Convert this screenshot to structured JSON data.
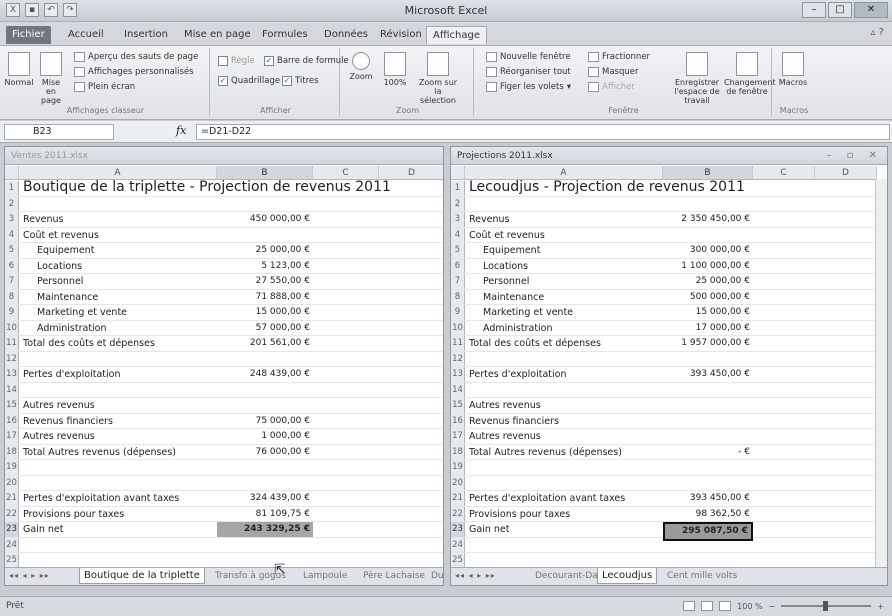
{
  "app": {
    "title": "Microsoft Excel"
  },
  "tabs": [
    "Fichier",
    "Accueil",
    "Insertion",
    "Mise en page",
    "Formules",
    "Données",
    "Révision",
    "Affichage"
  ],
  "active_tab": "Affichage",
  "ribbon": {
    "workbook_views": {
      "normal": "Normal",
      "page_layout": "Mise en page",
      "page_break": "Aperçu des sauts de page",
      "custom": "Affichages personnalisés",
      "fullscreen": "Plein écran",
      "label": "Affichages classeur"
    },
    "show": {
      "ruler": "Règle",
      "formula_bar": "Barre de formule",
      "gridlines": "Quadrillage",
      "headings": "Titres",
      "label": "Afficher"
    },
    "zoom": {
      "zoom": "Zoom",
      "zoom100": "100%",
      "zoom_sel": "Zoom sur la sélection",
      "label": "Zoom"
    },
    "window": {
      "new_window": "Nouvelle fenêtre",
      "arrange_all": "Réorganiser tout",
      "freeze": "Figer les volets",
      "split": "Fractionner",
      "hide": "Masquer",
      "unhide": "Afficher",
      "save_ws": "Enregistrer l'espace de travail",
      "switch_windows": "Changement de fenêtre",
      "label": "Fenêtre"
    },
    "macros": {
      "macros": "Macros",
      "label": "Macros"
    }
  },
  "formula_bar": {
    "name_box": "B23",
    "fx": "fx",
    "formula": "=D21-D22"
  },
  "left_window": {
    "title": "Ventes 2011.xlsx",
    "columns": [
      "A",
      "B",
      "C",
      "D"
    ],
    "rows": [
      {
        "n": "1",
        "a": "Boutique de la triplette - Projection de revenus 2011",
        "b": "",
        "style": "big"
      },
      {
        "n": "2",
        "a": "",
        "b": ""
      },
      {
        "n": "3",
        "a": "Revenus",
        "b": "450 000,00 €"
      },
      {
        "n": "4",
        "a": "Coût et revenus",
        "b": ""
      },
      {
        "n": "5",
        "a": "Equipement",
        "b": "25 000,00 €",
        "style": "indent"
      },
      {
        "n": "6",
        "a": "Locations",
        "b": "5 123,00 €",
        "style": "indent"
      },
      {
        "n": "7",
        "a": "Personnel",
        "b": "27 550,00 €",
        "style": "indent"
      },
      {
        "n": "8",
        "a": "Maintenance",
        "b": "71 888,00 €",
        "style": "indent"
      },
      {
        "n": "9",
        "a": "Marketing et vente",
        "b": "15 000,00 €",
        "style": "indent"
      },
      {
        "n": "10",
        "a": "Administration",
        "b": "57 000,00 €",
        "style": "indent"
      },
      {
        "n": "11",
        "a": "Total des coûts et dépenses",
        "b": "201 561,00 €"
      },
      {
        "n": "12",
        "a": "",
        "b": ""
      },
      {
        "n": "13",
        "a": "Pertes d'exploitation",
        "b": "248 439,00 €"
      },
      {
        "n": "14",
        "a": "",
        "b": ""
      },
      {
        "n": "15",
        "a": "Autres revenus",
        "b": ""
      },
      {
        "n": "16",
        "a": "Revenus financiers",
        "b": "75 000,00 €"
      },
      {
        "n": "17",
        "a": "Autres revenus",
        "b": "1 000,00 €"
      },
      {
        "n": "18",
        "a": "Total Autres revenus (dépenses)",
        "b": "76 000,00 €"
      },
      {
        "n": "19",
        "a": "",
        "b": ""
      },
      {
        "n": "20",
        "a": "",
        "b": ""
      },
      {
        "n": "21",
        "a": "Pertes d'exploitation avant taxes",
        "b": "324 439,00 €"
      },
      {
        "n": "22",
        "a": "Provisions pour taxes",
        "b": "81 109,75 €"
      },
      {
        "n": "23",
        "a": "Gain net",
        "b": "243 329,25 €",
        "style": "sel"
      },
      {
        "n": "24",
        "a": "",
        "b": ""
      },
      {
        "n": "25",
        "a": "",
        "b": ""
      }
    ],
    "sheets": [
      "Boutique de la triplette",
      "Transfo à gogos",
      "Lampoule",
      "Père Lachaise",
      "Du"
    ],
    "active_sheet": "Boutique de la triplette"
  },
  "right_window": {
    "title": "Projections 2011.xlsx",
    "columns": [
      "A",
      "B",
      "C",
      "D"
    ],
    "rows": [
      {
        "n": "1",
        "a": "Lecoudjus - Projection de revenus 2011",
        "b": "",
        "style": "big"
      },
      {
        "n": "2",
        "a": "",
        "b": ""
      },
      {
        "n": "3",
        "a": "Revenus",
        "b": "2 350 450,00 €"
      },
      {
        "n": "4",
        "a": "Coût et revenus",
        "b": ""
      },
      {
        "n": "5",
        "a": "Equipement",
        "b": "300 000,00 €",
        "style": "indent"
      },
      {
        "n": "6",
        "a": "Locations",
        "b": "1 100 000,00 €",
        "style": "indent"
      },
      {
        "n": "7",
        "a": "Personnel",
        "b": "25 000,00 €",
        "style": "indent"
      },
      {
        "n": "8",
        "a": "Maintenance",
        "b": "500 000,00 €",
        "style": "indent"
      },
      {
        "n": "9",
        "a": "Marketing et vente",
        "b": "15 000,00 €",
        "style": "indent"
      },
      {
        "n": "10",
        "a": "Administration",
        "b": "17 000,00 €",
        "style": "indent"
      },
      {
        "n": "11",
        "a": "Total des coûts et dépenses",
        "b": "1 957 000,00 €"
      },
      {
        "n": "12",
        "a": "",
        "b": ""
      },
      {
        "n": "13",
        "a": "Pertes d'exploitation",
        "b": "393 450,00 €"
      },
      {
        "n": "14",
        "a": "",
        "b": ""
      },
      {
        "n": "15",
        "a": "Autres revenus",
        "b": ""
      },
      {
        "n": "16",
        "a": "Revenus financiers",
        "b": ""
      },
      {
        "n": "17",
        "a": "Autres revenus",
        "b": ""
      },
      {
        "n": "18",
        "a": "Total Autres revenus (dépenses)",
        "b": "- €"
      },
      {
        "n": "19",
        "a": "",
        "b": ""
      },
      {
        "n": "20",
        "a": "",
        "b": ""
      },
      {
        "n": "21",
        "a": "Pertes d'exploitation avant taxes",
        "b": "393 450,00 €"
      },
      {
        "n": "22",
        "a": "Provisions pour taxes",
        "b": "98 362,50 €"
      },
      {
        "n": "23",
        "a": "Gain net",
        "b": "295 087,50 €",
        "style": "selb"
      },
      {
        "n": "24",
        "a": "",
        "b": ""
      },
      {
        "n": "25",
        "a": "",
        "b": ""
      }
    ],
    "sheets": [
      "Decourant-Dair",
      "Lecoudjus",
      "Cent mille volts"
    ],
    "active_sheet": "Lecoudjus"
  },
  "status": {
    "ready": "Prêt",
    "zoom": "100 %",
    "minus": "−",
    "plus": "+"
  },
  "colors": {
    "selected_cell": "#a6a6a6",
    "file_tab": "#707782"
  }
}
